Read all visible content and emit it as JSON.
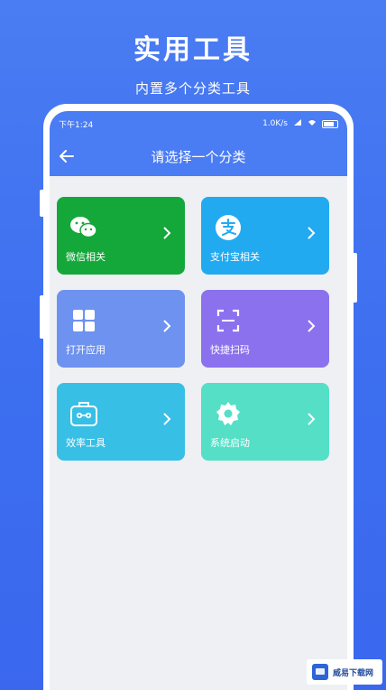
{
  "hero": {
    "title": "实用工具",
    "subtitle": "内置多个分类工具"
  },
  "statusbar": {
    "time": "下午1:24",
    "network": "1.0K/s"
  },
  "appbar": {
    "title": "请选择一个分类"
  },
  "categories": [
    {
      "label": "微信相关",
      "icon": "wechat-icon",
      "color": "#14a83a"
    },
    {
      "label": "支付宝相关",
      "icon": "alipay-icon",
      "color": "#22aaf1"
    },
    {
      "label": "打开应用",
      "icon": "apps-grid-icon",
      "color": "#6e92f0"
    },
    {
      "label": "快捷扫码",
      "icon": "scan-icon",
      "color": "#8b71ee"
    },
    {
      "label": "效率工具",
      "icon": "toolbox-icon",
      "color": "#37bfe6"
    },
    {
      "label": "系统启动",
      "icon": "gear-icon",
      "color": "#55dfc7"
    }
  ],
  "watermark": {
    "text": "威易下载网"
  },
  "colors": {
    "accent": "#4a7cf3",
    "screen_bg": "#eef0f4"
  }
}
